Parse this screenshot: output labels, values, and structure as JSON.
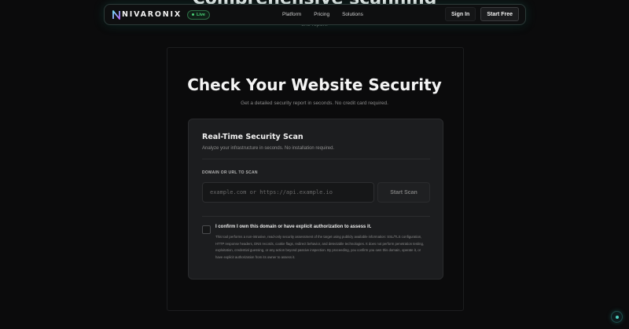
{
  "background": {
    "heading": "Comprehensive scanning",
    "subtext": "one report."
  },
  "navbar": {
    "logo_text": "NIVARONIX",
    "live_badge": "Live",
    "links": [
      "Platform",
      "Pricing",
      "Solutions"
    ],
    "sign_in": "Sign In",
    "start_free": "Start Free"
  },
  "hero": {
    "title": "Check Your Website Security",
    "subtitle": "Get a detailed security report in seconds. No credit card required."
  },
  "scan_card": {
    "title": "Real-Time Security Scan",
    "subtitle": "Analyze your infrastructure in seconds. No installation required.",
    "field_label": "DOMAIN OR URL TO SCAN",
    "input_value": "",
    "input_placeholder": "example.com or https://api.example.io",
    "scan_button": "Start Scan",
    "confirm_checked": false,
    "confirm_label": "I confirm I own this domain or have explicit authorization to assess it.",
    "disclaimer": "This tool performs a non-intrusive, read-only security assessment of the target using publicly available information: SSL/TLS configuration, HTTP response headers, DNS records, cookie flags, redirect behavior, and detectable technologies. It does not perform penetration testing, exploitation, credential guessing, or any action beyond passive inspection. By proceeding, you confirm you own this domain, operate it, or have explicit authorization from its owner to assess it."
  },
  "colors": {
    "background": "#0b0b0c",
    "card": "#1c1d1f",
    "accent_live": "#49d277",
    "accent_teal": "#4fd2c2"
  },
  "icons": {
    "logo": "nivaronix-logo-icon",
    "live": "live-dot-icon",
    "corner": "assistant-dot-icon"
  }
}
